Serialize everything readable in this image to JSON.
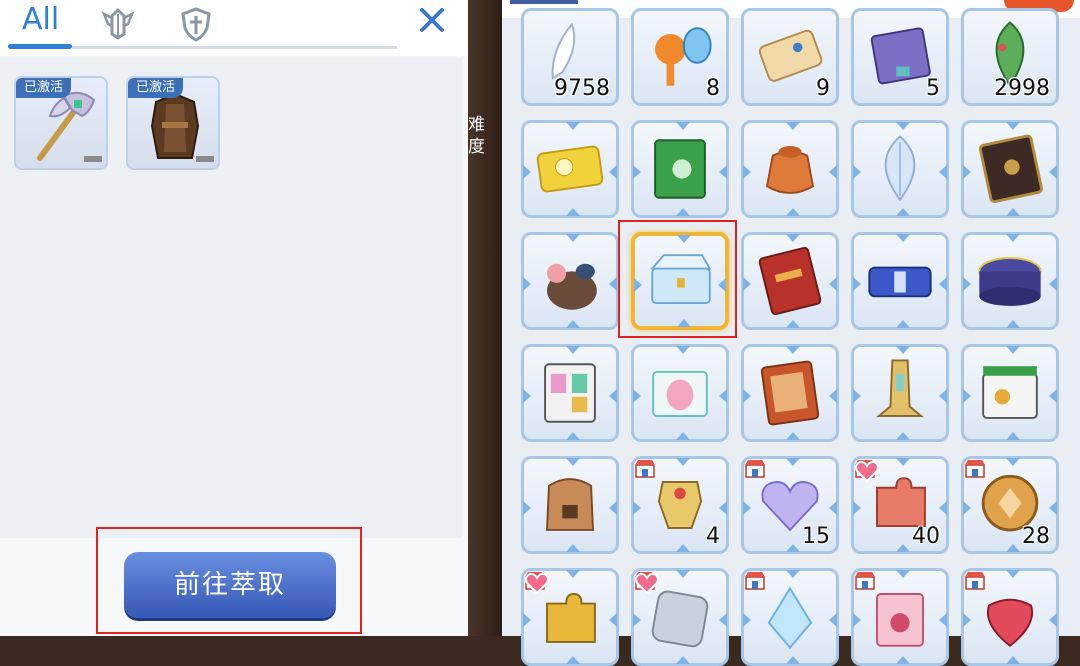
{
  "left_panel": {
    "tabs": [
      {
        "label": "All",
        "icon": null
      },
      {
        "label": "",
        "icon": "winged-helmet-icon"
      },
      {
        "label": "",
        "icon": "shield-cross-icon"
      }
    ],
    "close_icon": "close-icon",
    "equipment": [
      {
        "name": "axe",
        "badge": "已激活"
      },
      {
        "name": "armor",
        "badge": "已激活"
      }
    ],
    "extract_button": "前往萃取"
  },
  "middle": {
    "texts": [
      "难",
      "度"
    ]
  },
  "inventory": {
    "rows": [
      [
        {
          "icon": "feather-icon",
          "count": "9758"
        },
        {
          "icon": "orange-hammer-icon",
          "count": "8"
        },
        {
          "icon": "scroll-icon",
          "count": "9"
        },
        {
          "icon": "purple-book-icon",
          "count": "5"
        },
        {
          "icon": "leaf-icon",
          "count": "2998"
        }
      ],
      [
        {
          "icon": "golden-ticket-icon",
          "count": ""
        },
        {
          "icon": "green-book-icon",
          "count": ""
        },
        {
          "icon": "coin-bag-icon",
          "count": ""
        },
        {
          "icon": "crystal-leaf-icon",
          "count": ""
        },
        {
          "icon": "dark-tome-icon",
          "count": ""
        }
      ],
      [
        {
          "icon": "paw-bag-icon",
          "count": ""
        },
        {
          "icon": "crystal-chest-icon",
          "count": "",
          "selected": true
        },
        {
          "icon": "red-book-icon",
          "count": ""
        },
        {
          "icon": "blue-case-icon",
          "count": ""
        },
        {
          "icon": "magic-box-icon",
          "count": ""
        }
      ],
      [
        {
          "icon": "wardrobe-icon",
          "count": ""
        },
        {
          "icon": "egg-box-icon",
          "count": ""
        },
        {
          "icon": "card-book-icon",
          "count": ""
        },
        {
          "icon": "golden-stand-icon",
          "count": ""
        },
        {
          "icon": "mystery-box-icon",
          "count": ""
        }
      ],
      [
        {
          "icon": "backpack-icon",
          "count": ""
        },
        {
          "icon": "gold-armor-icon",
          "count": "4",
          "shop": true
        },
        {
          "icon": "crystal-heart-icon",
          "count": "15",
          "shop": true
        },
        {
          "icon": "puzzle-piece-icon",
          "count": "40",
          "shop": true,
          "heart": true
        },
        {
          "icon": "amber-coin-icon",
          "count": "28",
          "shop": true
        }
      ],
      [
        {
          "icon": "gold-puzzle-icon",
          "count": "",
          "shop": true,
          "heart": true
        },
        {
          "icon": "silver-plate-icon",
          "count": "",
          "shop": true,
          "heart": true
        },
        {
          "icon": "ice-crystal-icon",
          "count": "",
          "shop": true
        },
        {
          "icon": "pink-card-icon",
          "count": "",
          "shop": true
        },
        {
          "icon": "strawberry-icon",
          "count": "",
          "shop": true
        }
      ]
    ]
  },
  "colors": {
    "accent": "#2e7fd6",
    "highlight": "#e0231f",
    "button": "#3d5fbd",
    "selected": "#f2b533"
  }
}
